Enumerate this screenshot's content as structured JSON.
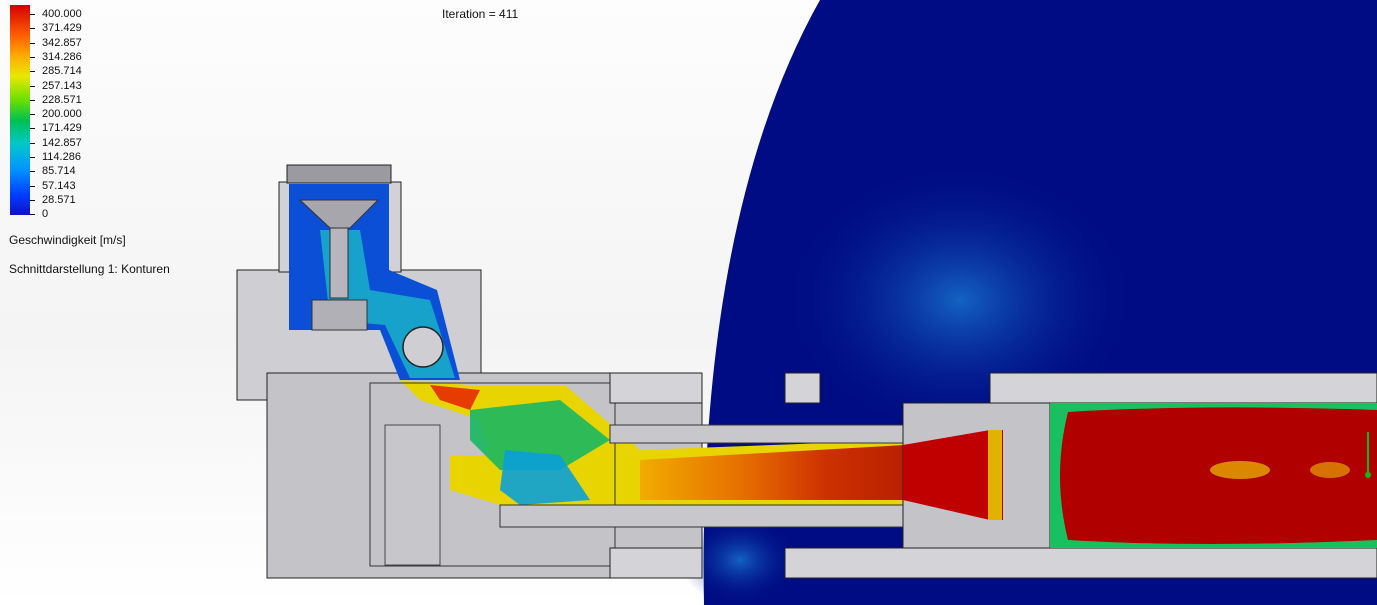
{
  "legend": {
    "ticks": [
      "400.000",
      "371.429",
      "342.857",
      "314.286",
      "285.714",
      "257.143",
      "228.571",
      "200.000",
      "171.429",
      "142.857",
      "114.286",
      "85.714",
      "57.143",
      "28.571",
      "0"
    ],
    "quantity_label": "Geschwindigkeit [m/s]",
    "section_label": "Schnittdarstellung 1: Konturen"
  },
  "iteration_text": "Iteration = 411",
  "colors": {
    "fluid_background": "#000c84",
    "solid_grey": "#c8c8cc",
    "max_red": "#b30000"
  }
}
